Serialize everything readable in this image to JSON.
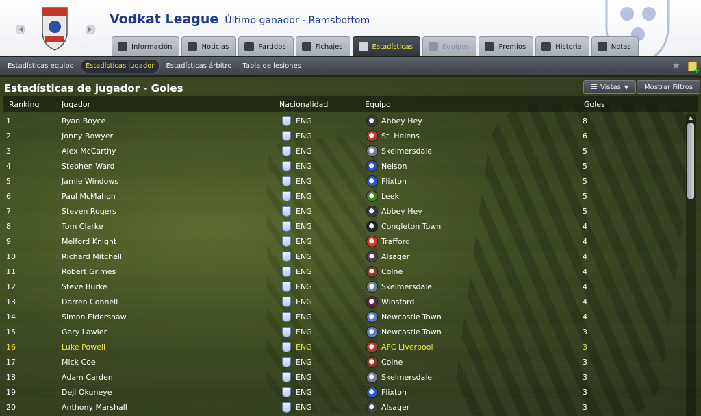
{
  "header": {
    "league_name": "Vodkat League",
    "winner_text": "Último ganador - Ramsbottom"
  },
  "tabs": [
    {
      "label": "Información",
      "name": "tab-informacion",
      "icon": "list-icon",
      "state": "normal"
    },
    {
      "label": "Noticias",
      "name": "tab-noticias",
      "icon": "newspaper-icon",
      "state": "normal"
    },
    {
      "label": "Partidos",
      "name": "tab-partidos",
      "icon": "ball-icon",
      "state": "normal"
    },
    {
      "label": "Fichajes",
      "name": "tab-fichajes",
      "icon": "transfer-arrows-icon",
      "state": "normal"
    },
    {
      "label": "Estadísticas",
      "name": "tab-estadisticas",
      "icon": "bar-chart-icon",
      "state": "active"
    },
    {
      "label": "Equipos",
      "name": "tab-equipos",
      "icon": "shield-icon",
      "state": "disabled"
    },
    {
      "label": "Premios",
      "name": "tab-premios",
      "icon": "trophy-icon",
      "state": "normal"
    },
    {
      "label": "Historia",
      "name": "tab-historia",
      "icon": "document-icon",
      "state": "normal"
    },
    {
      "label": "Notas",
      "name": "tab-notas",
      "icon": "note-icon",
      "state": "normal"
    }
  ],
  "subnav": [
    {
      "label": "Estadísticas equipo",
      "active": false
    },
    {
      "label": "Estadísticas jugador",
      "active": true
    },
    {
      "label": "Estadísticas árbitro",
      "active": false
    },
    {
      "label": "Tabla de lesiones",
      "active": false
    }
  ],
  "panel": {
    "title": "Estadísticas de jugador - Goles",
    "views_label": "Vistas",
    "filters_label": "Mostrar Filtros"
  },
  "columns": {
    "rank": "Ranking",
    "player": "Jugador",
    "nationality": "Nacionalidad",
    "team": "Equipo",
    "goals": "Goles"
  },
  "rows": [
    {
      "rank": "1",
      "player": "Ryan Boyce",
      "nat": "ENG",
      "team": "Abbey Hey",
      "goals": "8",
      "highlight": false,
      "badge_color": "#3a3a3a"
    },
    {
      "rank": "2",
      "player": "Jonny Bowyer",
      "nat": "ENG",
      "team": "St. Helens",
      "goals": "6",
      "highlight": false,
      "badge_color": "#c0392b"
    },
    {
      "rank": "3",
      "player": "Alex McCarthy",
      "nat": "ENG",
      "team": "Skelmersdale",
      "goals": "5",
      "highlight": false,
      "badge_color": "#6f7f9a"
    },
    {
      "rank": "4",
      "player": "Stephen Ward",
      "nat": "ENG",
      "team": "Nelson",
      "goals": "5",
      "highlight": false,
      "badge_color": "#2c4fa3"
    },
    {
      "rank": "5",
      "player": "Jamie Windows",
      "nat": "ENG",
      "team": "Flixton",
      "goals": "5",
      "highlight": false,
      "badge_color": "#2f55c2"
    },
    {
      "rank": "6",
      "player": "Paul McMahon",
      "nat": "ENG",
      "team": "Leek",
      "goals": "5",
      "highlight": false,
      "badge_color": "#3f7f2f"
    },
    {
      "rank": "7",
      "player": "Steven Rogers",
      "nat": "ENG",
      "team": "Abbey Hey",
      "goals": "5",
      "highlight": false,
      "badge_color": "#3a3a3a"
    },
    {
      "rank": "8",
      "player": "Tom Clarke",
      "nat": "ENG",
      "team": "Congleton Town",
      "goals": "4",
      "highlight": false,
      "badge_color": "#222222"
    },
    {
      "rank": "9",
      "player": "Melford Knight",
      "nat": "ENG",
      "team": "Trafford",
      "goals": "4",
      "highlight": false,
      "badge_color": "#d0392b"
    },
    {
      "rank": "10",
      "player": "Richard Mitchell",
      "nat": "ENG",
      "team": "Alsager",
      "goals": "4",
      "highlight": false,
      "badge_color": "#444444"
    },
    {
      "rank": "11",
      "player": "Robert Grimes",
      "nat": "ENG",
      "team": "Colne",
      "goals": "4",
      "highlight": false,
      "badge_color": "#8a3a2a"
    },
    {
      "rank": "12",
      "player": "Steve Burke",
      "nat": "ENG",
      "team": "Skelmersdale",
      "goals": "4",
      "highlight": false,
      "badge_color": "#6f7f9a"
    },
    {
      "rank": "13",
      "player": "Darren Connell",
      "nat": "ENG",
      "team": "Winsford",
      "goals": "4",
      "highlight": false,
      "badge_color": "#5a2a4a"
    },
    {
      "rank": "14",
      "player": "Simon Eldershaw",
      "nat": "ENG",
      "team": "Newcastle Town",
      "goals": "4",
      "highlight": false,
      "badge_color": "#5b7bc0"
    },
    {
      "rank": "15",
      "player": "Gary Lawler",
      "nat": "ENG",
      "team": "Newcastle Town",
      "goals": "3",
      "highlight": false,
      "badge_color": "#5b7bc0"
    },
    {
      "rank": "16",
      "player": "Luke Powell",
      "nat": "ENG",
      "team": "AFC Liverpool",
      "goals": "3",
      "highlight": true,
      "badge_color": "#b03a2e"
    },
    {
      "rank": "17",
      "player": "Mick Coe",
      "nat": "ENG",
      "team": "Colne",
      "goals": "3",
      "highlight": false,
      "badge_color": "#8a3a2a"
    },
    {
      "rank": "18",
      "player": "Adam Carden",
      "nat": "ENG",
      "team": "Skelmersdale",
      "goals": "3",
      "highlight": false,
      "badge_color": "#6f7f9a"
    },
    {
      "rank": "19",
      "player": "Deji Okuneye",
      "nat": "ENG",
      "team": "Flixton",
      "goals": "3",
      "highlight": false,
      "badge_color": "#2f55c2"
    },
    {
      "rank": "20",
      "player": "Anthony Marshall",
      "nat": "ENG",
      "team": "Alsager",
      "goals": "3",
      "highlight": false,
      "badge_color": "#444444"
    }
  ]
}
